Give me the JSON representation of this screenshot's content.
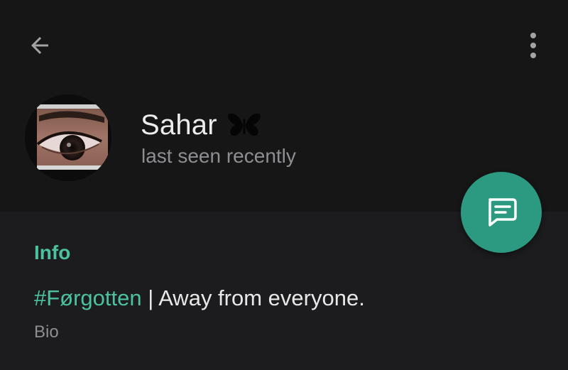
{
  "header": {
    "back_icon": "arrow-left-icon",
    "more_icon": "more-vertical-icon"
  },
  "profile": {
    "name": "Sahar",
    "name_emoji_icon": "butterfly-icon",
    "status": "last seen recently",
    "avatar": "eye-photo-avatar"
  },
  "fab": {
    "icon": "message-icon",
    "color": "#2c9a80"
  },
  "info": {
    "section_title": "Info",
    "bio_hashtag": "#Førgotten",
    "bio_text": " | Away from everyone.",
    "bio_label": "Bio"
  },
  "colors": {
    "accent": "#4cc1a0",
    "header_bg": "#161616",
    "body_bg": "#1c1c1e",
    "secondary_text": "#8e8e93"
  }
}
